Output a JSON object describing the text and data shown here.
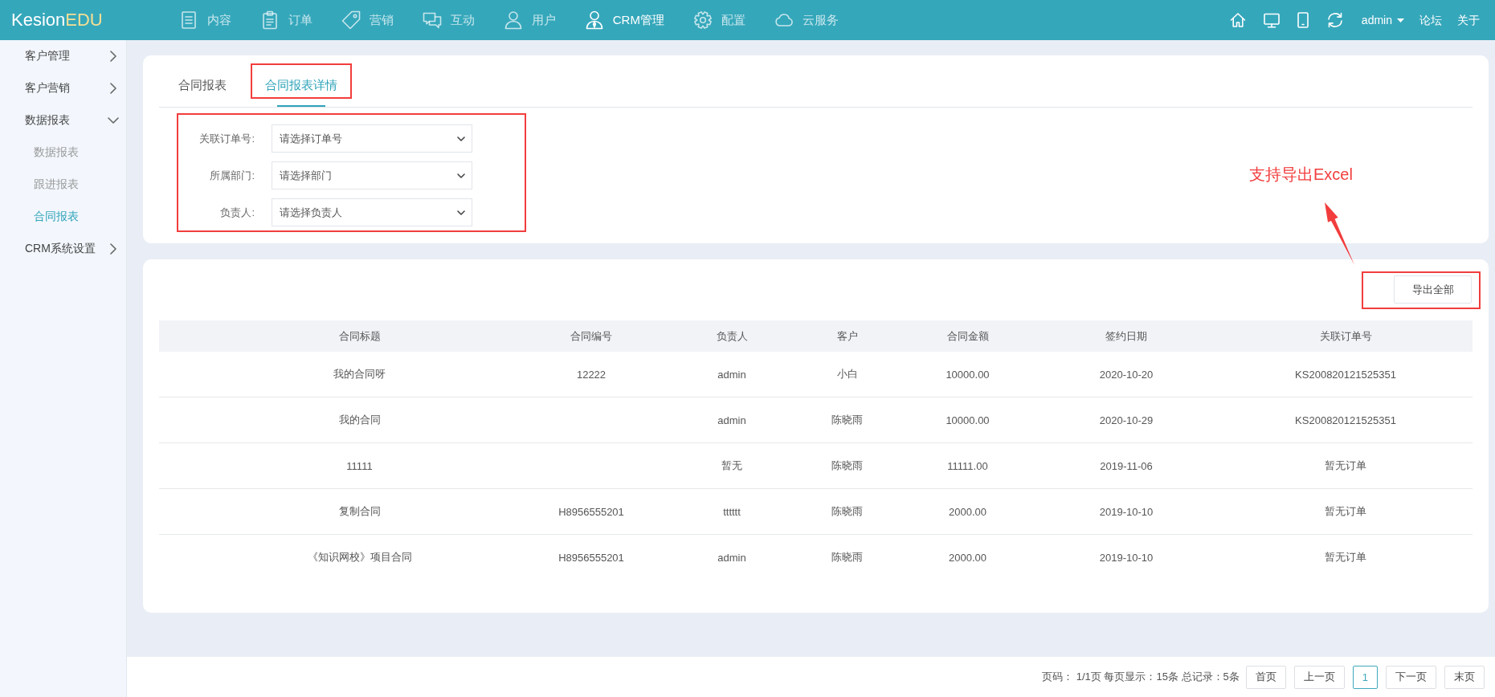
{
  "header": {
    "logo": {
      "text": "Kesion",
      "accent": "EDU"
    },
    "nav": [
      {
        "label": "内容",
        "selected": false
      },
      {
        "label": "订单",
        "selected": false
      },
      {
        "label": "营销",
        "selected": false
      },
      {
        "label": "互动",
        "selected": false
      },
      {
        "label": "用户",
        "selected": false
      },
      {
        "label": "CRM管理",
        "selected": true
      },
      {
        "label": "配置",
        "selected": false
      },
      {
        "label": "云服务",
        "selected": false
      }
    ],
    "user": "admin",
    "links": [
      "论坛",
      "关于"
    ]
  },
  "sidebar": {
    "items": [
      {
        "label": "客户管理",
        "expanded": false,
        "selected": false
      },
      {
        "label": "客户营销",
        "expanded": false,
        "selected": false
      },
      {
        "label": "数据报表",
        "expanded": true,
        "selected": false,
        "children": [
          {
            "label": "数据报表",
            "selected": false
          },
          {
            "label": "跟进报表",
            "selected": false
          },
          {
            "label": "合同报表",
            "selected": true
          }
        ]
      },
      {
        "label": "CRM系统设置",
        "expanded": false,
        "selected": false
      }
    ]
  },
  "tabs": [
    {
      "label": "合同报表",
      "selected": false,
      "highlighted": false
    },
    {
      "label": "合同报表详情",
      "selected": true,
      "highlighted": true
    }
  ],
  "filters": {
    "highlighted": true,
    "fields": [
      {
        "label": "关联订单号:",
        "placeholder": "请选择订单号"
      },
      {
        "label": "所属部门:",
        "placeholder": "请选择部门"
      },
      {
        "label": "负责人:",
        "placeholder": "请选择负责人"
      }
    ]
  },
  "annotation": {
    "text": "支持导出Excel"
  },
  "export_button": {
    "label": "导出全部",
    "highlighted": true
  },
  "table": {
    "columns": [
      "合同标题",
      "合同编号",
      "负责人",
      "客户",
      "合同金额",
      "签约日期",
      "关联订单号"
    ],
    "rows": [
      {
        "title": "我的合同呀",
        "contract_no": "12222",
        "owner": "admin",
        "customer": "小白",
        "amount": "10000.00",
        "signed_date": "2020-10-20",
        "order_no": "KS200820121525351"
      },
      {
        "title": "我的合同",
        "owner": "admin",
        "customer": "陈晓雨",
        "amount": "10000.00",
        "signed_date": "2020-10-29",
        "order_no": "KS200820121525351"
      },
      {
        "title": "11111",
        "owner": "暂无",
        "customer": "陈晓雨",
        "amount": "11111.00",
        "signed_date": "2019-11-06",
        "order_no": "暂无订单"
      },
      {
        "title": "复制合同",
        "contract_no": "H8956555201",
        "owner": "tttttt",
        "customer": "陈晓雨",
        "amount": "2000.00",
        "signed_date": "2019-10-10",
        "order_no": "暂无订单"
      },
      {
        "title": "《知识网校》项目合同",
        "contract_no": "H8956555201",
        "owner": "admin",
        "customer": "陈晓雨",
        "amount": "2000.00",
        "signed_date": "2019-10-10",
        "order_no": "暂无订单"
      }
    ]
  },
  "pagination": {
    "summary": "页码： 1/1页 每页显示：15条 总记录：5条",
    "buttons": [
      {
        "label": "首页",
        "selected": false
      },
      {
        "label": "上一页",
        "selected": false
      },
      {
        "label": "1",
        "selected": true
      },
      {
        "label": "下一页",
        "selected": false
      },
      {
        "label": "末页",
        "selected": false
      }
    ]
  }
}
